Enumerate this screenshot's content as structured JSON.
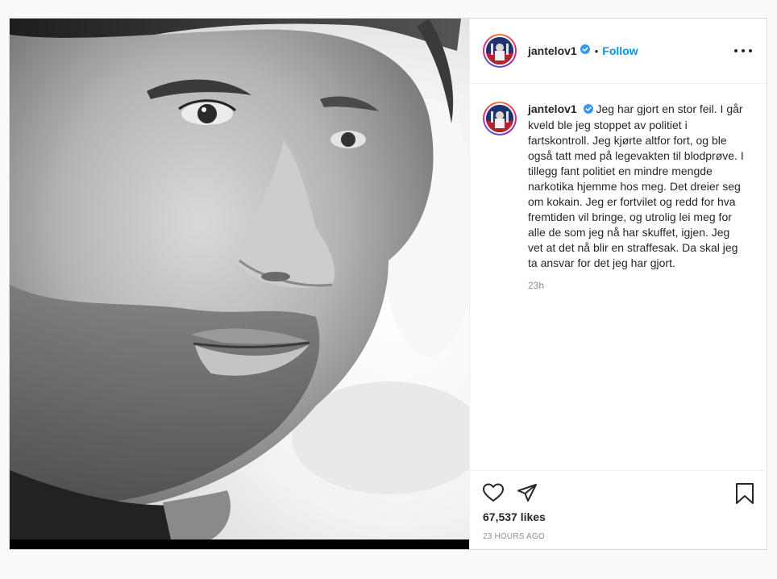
{
  "post": {
    "username": "jantelov1",
    "verified": true,
    "follow_label": "Follow",
    "separator": "•",
    "caption_username": "jantelov1",
    "caption": "Jeg har gjort en stor feil. I går kveld ble jeg stoppet av politiet i fartskontroll. Jeg kjørte altfor fort, og ble også tatt med på legevakten til blodprøve. I tillegg fant politiet en mindre mengde narkotika hjemme hos meg. Det dreier seg om kokain. Jeg er fortvilet og redd for hva fremtiden vil bringe, og utrolig lei meg for alle de som jeg nå har skuffet, igjen. Jeg vet at det nå blir en straffesak. Da skal jeg ta ansvar for det jeg har gjort.",
    "caption_time": "23h",
    "likes": "67,537 likes",
    "posted_ago": "23 HOURS AGO"
  },
  "icons": {
    "like": "heart-icon",
    "share": "send-icon",
    "save": "bookmark-icon",
    "more": "more-options-icon",
    "verified": "verified-badge-icon"
  },
  "colors": {
    "follow": "#0095f6",
    "verified": "#3897f0",
    "muted": "#8e8e8e"
  }
}
